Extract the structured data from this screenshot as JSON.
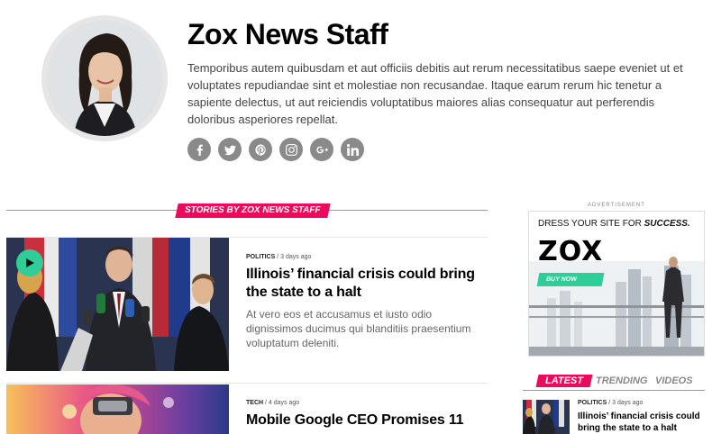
{
  "author": {
    "name": "Zox News Staff",
    "bio": "Temporibus autem quibusdam et aut officiis debitis aut rerum necessitatibus saepe eveniet ut et voluptates repudiandae sint et molestiae non recusandae. Itaque earum rerum hic tenetur a sapiente delectus, ut aut reiciendis voluptatibus maiores alias consequatur aut perferendis doloribus asperiores repellat.",
    "social": [
      {
        "icon": "facebook-icon",
        "glyph": "f"
      },
      {
        "icon": "twitter-icon",
        "glyph": "t"
      },
      {
        "icon": "pinterest-icon",
        "glyph": "p"
      },
      {
        "icon": "instagram-icon",
        "glyph": "ig"
      },
      {
        "icon": "google-plus-icon",
        "glyph": "G+"
      },
      {
        "icon": "linkedin-icon",
        "glyph": "in"
      }
    ]
  },
  "section": {
    "label": "STORIES BY ZOX NEWS STAFF"
  },
  "articles": [
    {
      "category": "POLITICS",
      "sep": "/",
      "time": "3 days ago",
      "title": "Illinois’ financial crisis could bring the state to a halt",
      "excerpt": "At vero eos et accusamus et iusto odio dignissimos ducimus qui blanditiis praesentium voluptatum deleniti.",
      "has_video": true
    },
    {
      "category": "TECH",
      "sep": "/",
      "time": "4 days ago",
      "title": "Mobile Google CEO Promises 11",
      "excerpt": ""
    }
  ],
  "sidebar": {
    "ad_label": "ADVERTISEMENT",
    "ad": {
      "headline_pre": "DRESS YOUR SITE FOR ",
      "headline_em": "SUCCESS.",
      "logo": "ZOX",
      "button": "BUY NOW"
    },
    "tabs": [
      "LATEST",
      "TRENDING",
      "VIDEOS"
    ],
    "latest_item": {
      "category": "POLITICS",
      "sep": "/",
      "time": "3 days ago",
      "title": "Illinois’ financial crisis could bring the state to a halt"
    }
  },
  "colors": {
    "accent": "#ec0a5c",
    "green": "#2fcd97",
    "social": "#8a8a8a"
  }
}
